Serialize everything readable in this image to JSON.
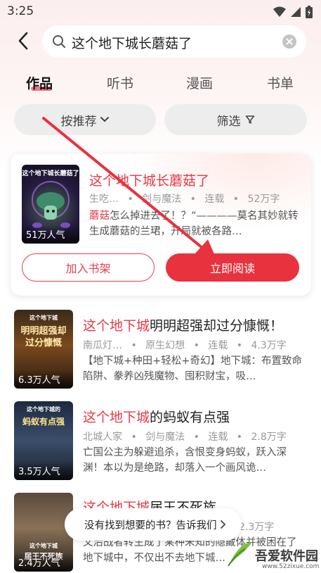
{
  "status_bar": {
    "time": "3:25"
  },
  "search": {
    "query": "这个地下城长蘑菇了"
  },
  "tabs": [
    {
      "label": "作品",
      "active": true
    },
    {
      "label": "听书",
      "active": false
    },
    {
      "label": "漫画",
      "active": false
    },
    {
      "label": "书单",
      "active": false
    }
  ],
  "filters": {
    "sort_label": "按推荐",
    "filter_label": "筛选"
  },
  "featured": {
    "title": "这个地下城长蘑菇了",
    "meta": {
      "author": "生吃…",
      "genre": "剑与魔法",
      "status": "连载",
      "words": "52万字"
    },
    "desc_highlight": "蘑菇",
    "desc": "怎么掉进去了！？”————莫名其妙就转生成蘑菇的兰珺，开局就被各路…",
    "cover_title": "这个地下城长蘑菇了",
    "popularity": "51万人气",
    "shelf_button": "加入书架",
    "read_button": "立即阅读"
  },
  "results": [
    {
      "title_highlight": "这个地下城",
      "title_rest": "明明超强却过分慷慨！",
      "author": "南瓜灯…",
      "genre": "原生幻想",
      "status": "连载",
      "words": "4.3万字",
      "desc": "【地下城+种田+轻松+奇幻】地下城：布置致命陷阱、豢养凶残魔物、囤积财宝，吸…",
      "cover_top": "这个地下城",
      "cover_title": "明明超强却过分慷慨",
      "popularity": "6.3万人气"
    },
    {
      "title_highlight": "这个地下城",
      "title_rest": "的蚂蚁有点强",
      "author": "北城人家",
      "genre": "剑与魔法",
      "status": "连载",
      "words": "2.8万字",
      "desc": "亡国公主为躲避追杀，含恨变身蚂蚁，跃入深渊！本以为是绝路，却落入一个画风诡…",
      "cover_top": "这个地下城的",
      "cover_title": "蚂蚁有点强",
      "popularity": "3.5万人气"
    },
    {
      "title_highlight": "这个地下城",
      "title_rest": "届王不死族",
      "words": "2.3万字",
      "desc": "文治战者转生成了某种未知的隐藏体并被困在了地下城中，不仅出不去地下城…",
      "cover_top": "这个地下城",
      "cover_title": "届王不死族",
      "popularity": "2.4万人气"
    }
  ],
  "feedback": {
    "text": "没有找到想要的书？告诉我们"
  },
  "watermark": {
    "text": "吾爱软件园",
    "url": "www.52zixue.com"
  },
  "colors": {
    "accent": "#e8323e",
    "highlight": "#e63946"
  },
  "icons": [
    "back-arrow-icon",
    "search-icon",
    "clear-icon",
    "chevron-down-icon",
    "filter-funnel-icon",
    "chevron-right-icon",
    "wifi-icon",
    "signal-icon",
    "battery-icon"
  ]
}
